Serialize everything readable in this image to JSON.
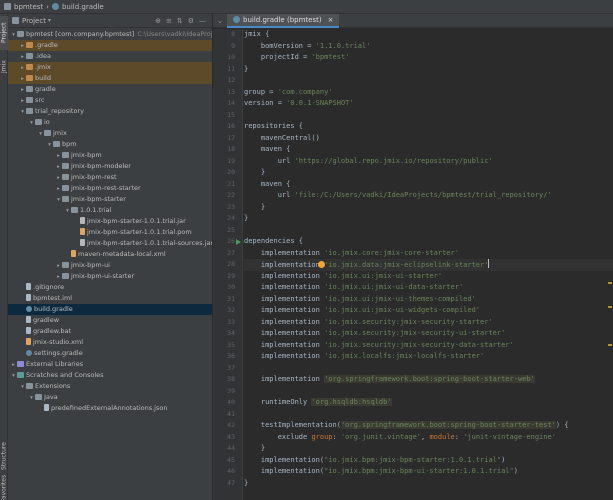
{
  "breadcrumb": {
    "project": "bpmtest",
    "file": "build.gradle"
  },
  "tool_stripe": {
    "project_label": "Project",
    "jmix_label": "Jmix",
    "structure_label": "Structure",
    "favorites_label": "Favorites"
  },
  "panel": {
    "title": "Project",
    "actions": [
      "⊕",
      "≡",
      "⇅",
      "⚙",
      "—"
    ]
  },
  "tree": [
    {
      "depth": 0,
      "arrow": "▾",
      "icon": "folder",
      "label": "bpmtest [com.company.bpmtest]",
      "hint": "C:\\Users\\vadki\\IdeaProjects\\bpmtest",
      "style": ""
    },
    {
      "depth": 1,
      "arrow": "▸",
      "icon": "folder-orange",
      "label": ".gradle",
      "hint": "",
      "style": "excluded"
    },
    {
      "depth": 1,
      "arrow": "▸",
      "icon": "folder",
      "label": ".idea",
      "hint": "",
      "style": ""
    },
    {
      "depth": 1,
      "arrow": "▸",
      "icon": "folder-orange",
      "label": ".jmix",
      "hint": "",
      "style": "excluded"
    },
    {
      "depth": 1,
      "arrow": "▸",
      "icon": "folder-orange",
      "label": "build",
      "hint": "",
      "style": "excluded"
    },
    {
      "depth": 1,
      "arrow": "▸",
      "icon": "folder",
      "label": "gradle",
      "hint": "",
      "style": ""
    },
    {
      "depth": 1,
      "arrow": "▸",
      "icon": "folder",
      "label": "src",
      "hint": "",
      "style": ""
    },
    {
      "depth": 1,
      "arrow": "▾",
      "icon": "folder",
      "label": "trial_repository",
      "hint": "",
      "style": ""
    },
    {
      "depth": 2,
      "arrow": "▾",
      "icon": "folder",
      "label": "io",
      "hint": "",
      "style": ""
    },
    {
      "depth": 3,
      "arrow": "▾",
      "icon": "folder",
      "label": "jmix",
      "hint": "",
      "style": ""
    },
    {
      "depth": 4,
      "arrow": "▾",
      "icon": "folder",
      "label": "bpm",
      "hint": "",
      "style": ""
    },
    {
      "depth": 5,
      "arrow": "▸",
      "icon": "folder",
      "label": "jmix-bpm",
      "hint": "",
      "style": ""
    },
    {
      "depth": 5,
      "arrow": "▸",
      "icon": "folder",
      "label": "jmix-bpm-modeler",
      "hint": "",
      "style": ""
    },
    {
      "depth": 5,
      "arrow": "▸",
      "icon": "folder",
      "label": "jmix-bpm-rest",
      "hint": "",
      "style": ""
    },
    {
      "depth": 5,
      "arrow": "▸",
      "icon": "folder",
      "label": "jmix-bpm-rest-starter",
      "hint": "",
      "style": ""
    },
    {
      "depth": 5,
      "arrow": "▾",
      "icon": "folder",
      "label": "jmix-bpm-starter",
      "hint": "",
      "style": ""
    },
    {
      "depth": 6,
      "arrow": "▾",
      "icon": "folder",
      "label": "1.0.1.trial",
      "hint": "",
      "style": ""
    },
    {
      "depth": 7,
      "arrow": "",
      "icon": "jar",
      "label": "jmix-bpm-starter-1.0.1.trial.jar",
      "hint": "",
      "style": ""
    },
    {
      "depth": 7,
      "arrow": "",
      "icon": "xml",
      "label": "jmix-bpm-starter-1.0.1.trial.pom",
      "hint": "",
      "style": ""
    },
    {
      "depth": 7,
      "arrow": "",
      "icon": "jar",
      "label": "jmix-bpm-starter-1.0.1.trial-sources.jar",
      "hint": "",
      "style": ""
    },
    {
      "depth": 6,
      "arrow": "",
      "icon": "xml",
      "label": "maven-metadata-local.xml",
      "hint": "",
      "style": ""
    },
    {
      "depth": 5,
      "arrow": "▸",
      "icon": "folder",
      "label": "jmix-bpm-ui",
      "hint": "",
      "style": ""
    },
    {
      "depth": 5,
      "arrow": "▸",
      "icon": "folder",
      "label": "jmix-bpm-ui-starter",
      "hint": "",
      "style": ""
    },
    {
      "depth": 1,
      "arrow": "",
      "icon": "file",
      "label": ".gitignore",
      "hint": "",
      "style": ""
    },
    {
      "depth": 1,
      "arrow": "",
      "icon": "file",
      "label": "bpmtest.iml",
      "hint": "",
      "style": ""
    },
    {
      "depth": 1,
      "arrow": "",
      "icon": "gradle",
      "label": "build.gradle",
      "hint": "",
      "style": "selected"
    },
    {
      "depth": 1,
      "arrow": "",
      "icon": "file",
      "label": "gradlew",
      "hint": "",
      "style": ""
    },
    {
      "depth": 1,
      "arrow": "",
      "icon": "file",
      "label": "gradlew.bat",
      "hint": "",
      "style": ""
    },
    {
      "depth": 1,
      "arrow": "",
      "icon": "xml",
      "label": "jmix-studio.xml",
      "hint": "",
      "style": ""
    },
    {
      "depth": 1,
      "arrow": "",
      "icon": "gradle",
      "label": "settings.gradle",
      "hint": "",
      "style": ""
    },
    {
      "depth": 0,
      "arrow": "▸",
      "icon": "lib",
      "label": "External Libraries",
      "hint": "",
      "style": ""
    },
    {
      "depth": 0,
      "arrow": "▾",
      "icon": "scratch",
      "label": "Scratches and Consoles",
      "hint": "",
      "style": ""
    },
    {
      "depth": 1,
      "arrow": "▾",
      "icon": "folder",
      "label": "Extensions",
      "hint": "",
      "style": ""
    },
    {
      "depth": 2,
      "arrow": "▾",
      "icon": "folder",
      "label": "Java",
      "hint": "",
      "style": ""
    },
    {
      "depth": 3,
      "arrow": "",
      "icon": "file",
      "label": "predefinedExternalAnnotations.json",
      "hint": "",
      "style": ""
    }
  ],
  "editor": {
    "tab_label": "build.gradle (bpmtest)",
    "lines": [
      {
        "num": "8",
        "parts": [
          [
            "n",
            "jmix {"
          ]
        ]
      },
      {
        "num": "9",
        "parts": [
          [
            "n",
            "    bomVersion = "
          ],
          [
            "s",
            "'1.1.0.trial'"
          ]
        ]
      },
      {
        "num": "10",
        "parts": [
          [
            "n",
            "    projectId = "
          ],
          [
            "s",
            "'bpmtest'"
          ]
        ]
      },
      {
        "num": "11",
        "parts": [
          [
            "n",
            "}"
          ]
        ]
      },
      {
        "num": "12",
        "parts": []
      },
      {
        "num": "13",
        "parts": [
          [
            "n",
            "group = "
          ],
          [
            "s",
            "'com.company'"
          ]
        ]
      },
      {
        "num": "14",
        "parts": [
          [
            "n",
            "version = "
          ],
          [
            "s",
            "'0.0.1-SNAPSHOT'"
          ]
        ]
      },
      {
        "num": "15",
        "parts": []
      },
      {
        "num": "16",
        "parts": [
          [
            "n",
            "repositories {"
          ]
        ]
      },
      {
        "num": "17",
        "parts": [
          [
            "n",
            "    mavenCentral()"
          ]
        ]
      },
      {
        "num": "18",
        "parts": [
          [
            "n",
            "    maven {"
          ]
        ]
      },
      {
        "num": "19",
        "parts": [
          [
            "n",
            "        url "
          ],
          [
            "s",
            "'https://global.repo.jmix.io/repository/public'"
          ]
        ]
      },
      {
        "num": "20",
        "parts": [
          [
            "n",
            "    }"
          ]
        ]
      },
      {
        "num": "21",
        "parts": [
          [
            "n",
            "    maven {"
          ]
        ]
      },
      {
        "num": "22",
        "parts": [
          [
            "n",
            "        url "
          ],
          [
            "s",
            "'file:/C:/Users/vadki/IdeaProjects/bpmtest/trial_repository/'"
          ]
        ]
      },
      {
        "num": "23",
        "parts": [
          [
            "n",
            "    }"
          ]
        ]
      },
      {
        "num": "24",
        "parts": [
          [
            "n",
            "}"
          ]
        ]
      },
      {
        "num": "25",
        "parts": []
      },
      {
        "num": "26",
        "parts": [
          [
            "n",
            "dependencies {"
          ]
        ],
        "run": true
      },
      {
        "num": "27",
        "parts": [
          [
            "n",
            "    implementation "
          ],
          [
            "s",
            "'io.jmix.core:jmix-core-starter'"
          ]
        ]
      },
      {
        "num": "28",
        "parts": [
          [
            "n",
            "    implementation "
          ],
          [
            "s",
            "'io.jmix.data:jmix-eclipselink-starter'"
          ]
        ],
        "current": true
      },
      {
        "num": "29",
        "parts": [
          [
            "n",
            "    implementation "
          ],
          [
            "s",
            "'io.jmix.ui:jmix-ui-starter'"
          ]
        ]
      },
      {
        "num": "30",
        "parts": [
          [
            "n",
            "    implementation "
          ],
          [
            "s",
            "'io.jmix.ui:jmix-ui-data-starter'"
          ]
        ]
      },
      {
        "num": "31",
        "parts": [
          [
            "n",
            "    implementation "
          ],
          [
            "s",
            "'io.jmix.ui:jmix-ui-themes-compiled'"
          ]
        ]
      },
      {
        "num": "32",
        "parts": [
          [
            "n",
            "    implementation "
          ],
          [
            "s",
            "'io.jmix.ui:jmix-ui-widgets-compiled'"
          ]
        ]
      },
      {
        "num": "33",
        "parts": [
          [
            "n",
            "    implementation "
          ],
          [
            "s",
            "'io.jmix.security:jmix-security-starter'"
          ]
        ]
      },
      {
        "num": "34",
        "parts": [
          [
            "n",
            "    implementation "
          ],
          [
            "s",
            "'io.jmix.security:jmix-security-ui-starter'"
          ]
        ]
      },
      {
        "num": "35",
        "parts": [
          [
            "n",
            "    implementation "
          ],
          [
            "s",
            "'io.jmix.security:jmix-security-data-starter'"
          ]
        ]
      },
      {
        "num": "36",
        "parts": [
          [
            "n",
            "    implementation "
          ],
          [
            "s",
            "'io.jmix.localfs:jmix-localfs-starter'"
          ]
        ]
      },
      {
        "num": "37",
        "parts": []
      },
      {
        "num": "38",
        "parts": [
          [
            "n",
            "    implementation "
          ],
          [
            "hl",
            "'org.springframework.boot:spring-boot-starter-web'"
          ]
        ]
      },
      {
        "num": "39",
        "parts": []
      },
      {
        "num": "40",
        "parts": [
          [
            "n",
            "    runtimeOnly "
          ],
          [
            "hl",
            "'org.hsqldb:hsqldb'"
          ]
        ]
      },
      {
        "num": "41",
        "parts": []
      },
      {
        "num": "42",
        "parts": [
          [
            "n",
            "    testImplementation("
          ],
          [
            "hl",
            "'org.springframework.boot:spring-boot-starter-test'"
          ],
          [
            "n",
            ") {"
          ]
        ]
      },
      {
        "num": "43",
        "parts": [
          [
            "n",
            "        exclude "
          ],
          [
            "k",
            "group"
          ],
          [
            "n",
            ": "
          ],
          [
            "s",
            "'org.junit.vintage'"
          ],
          [
            "n",
            ", "
          ],
          [
            "k",
            "module"
          ],
          [
            "n",
            ": "
          ],
          [
            "s",
            "'junit-vintage-engine'"
          ]
        ]
      },
      {
        "num": "44",
        "parts": [
          [
            "n",
            "    }"
          ]
        ]
      },
      {
        "num": "45",
        "parts": [
          [
            "n",
            "    implementation("
          ],
          [
            "s",
            "\"io.jmix.bpm:jmix-bpm-starter:1.0.1.trial\""
          ],
          [
            "n",
            ")"
          ]
        ]
      },
      {
        "num": "46",
        "parts": [
          [
            "n",
            "    implementation("
          ],
          [
            "s",
            "\"io.jmix.bpm:jmix-bpm-ui-starter:1.0.1.trial\""
          ],
          [
            "n",
            ")"
          ]
        ]
      },
      {
        "num": "47",
        "parts": [
          [
            "n",
            "}"
          ]
        ]
      }
    ]
  },
  "colors": {
    "accent": "#4a88c7",
    "string": "#6a8759",
    "keyword": "#cc7832",
    "excluded_folder_bg": "#5d4a29",
    "selection": "#0d293e"
  },
  "icons": {
    "project": "folder-icon",
    "gradle": "gradle-icon",
    "run": "run-gutter-icon",
    "bulb": "intention-bulb-icon"
  }
}
